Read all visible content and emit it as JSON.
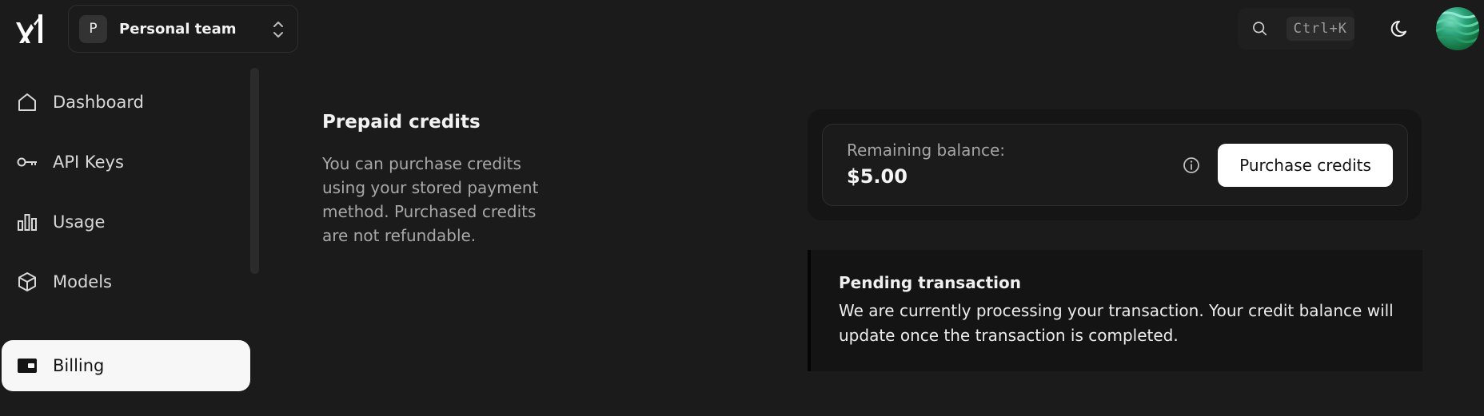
{
  "header": {
    "team": {
      "avatar_letter": "P",
      "name": "Personal team"
    },
    "search": {
      "shortcut": "Ctrl+K"
    }
  },
  "sidebar": {
    "items": [
      {
        "label": "Dashboard",
        "icon": "home-icon"
      },
      {
        "label": "API Keys",
        "icon": "key-icon"
      },
      {
        "label": "Usage",
        "icon": "bar-chart-icon"
      },
      {
        "label": "Models",
        "icon": "cube-icon"
      },
      {
        "label": "Billing",
        "icon": "wallet-icon",
        "active": true
      }
    ]
  },
  "main": {
    "prepaid": {
      "title": "Prepaid credits",
      "description": "You can purchase credits using your stored payment method. Purchased credits are not refundable."
    },
    "balance": {
      "label": "Remaining balance:",
      "value": "$5.00",
      "button_label": "Purchase credits"
    },
    "pending": {
      "title": "Pending transaction",
      "message": "We are currently processing your transaction. Your credit balance will update once the transaction is completed."
    }
  },
  "colors": {
    "background": "#1b1b1b",
    "active_nav_bg": "#f7f7f7",
    "button_bg": "#ffffff"
  }
}
